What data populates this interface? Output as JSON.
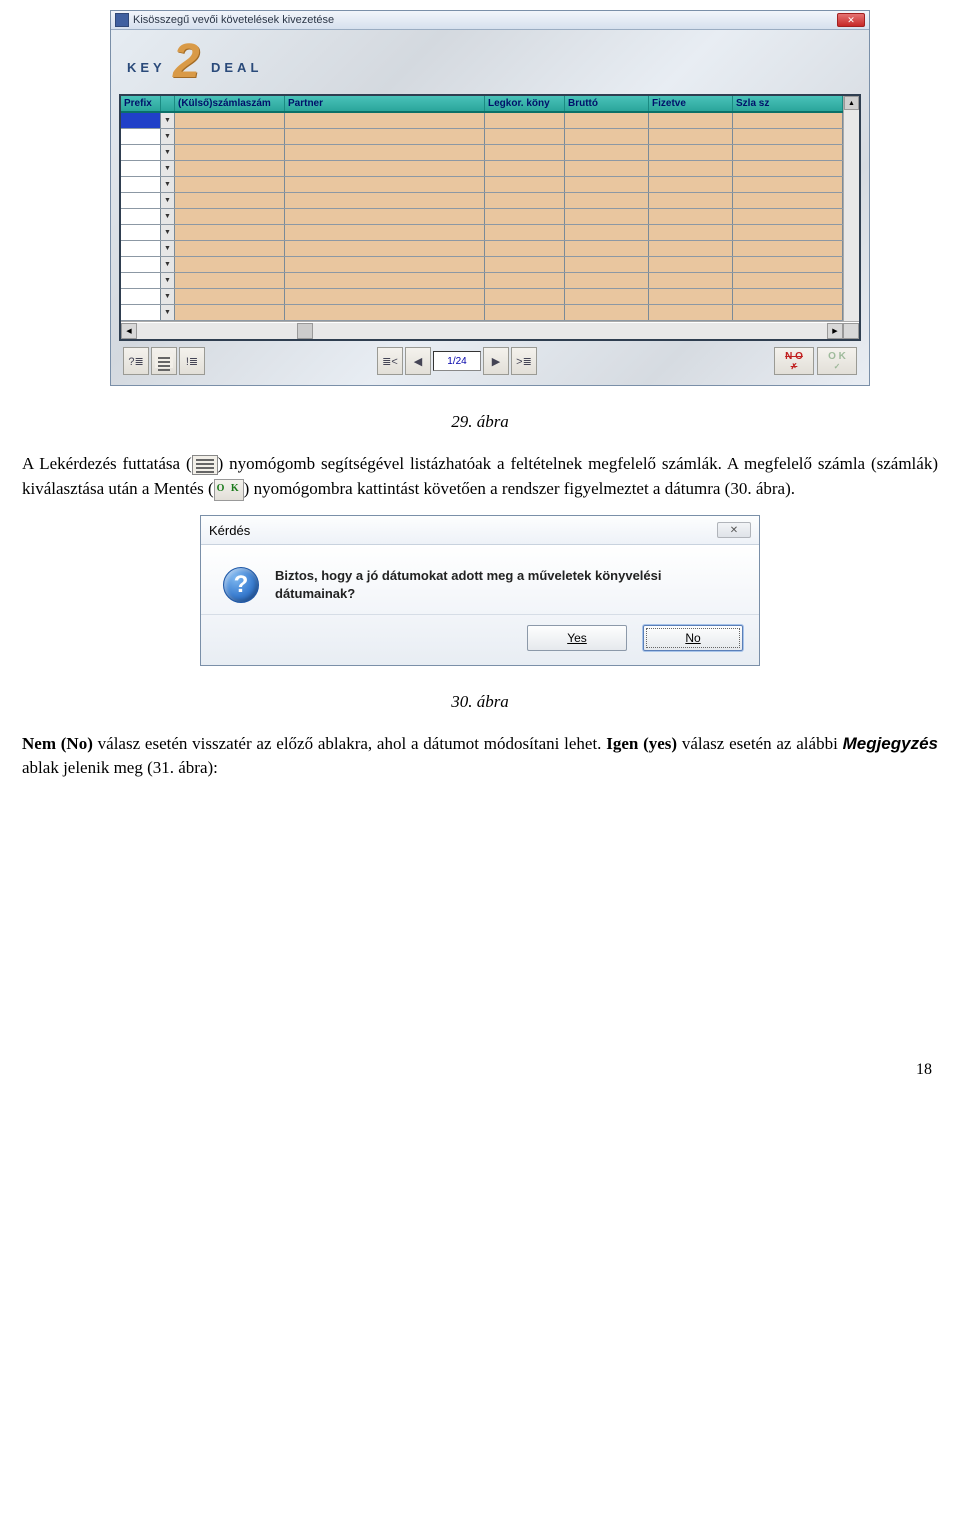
{
  "app1": {
    "title": "Kisösszegű vevői követelések kivezetése",
    "logo_key": "KEY",
    "logo_deal": "DEAL",
    "columns": {
      "prefix": "Prefix",
      "kulso": "(Külső)számlaszám",
      "partner": "Partner",
      "legkor": "Legkor. köny",
      "brutto": "Bruttó",
      "fizetve": "Fizetve",
      "szla": "Szla sz"
    },
    "dropdown_glyph": "▼",
    "page_indicator": "1/24",
    "no_label": "N O",
    "ok_label": "O K"
  },
  "caption1": "29. ábra",
  "paragraph1_a": "A Lekérdezés futtatása (",
  "paragraph1_b": ") nyomógomb segítségével listázhatóak a feltételnek megfelelő számlák. A megfelelő számla (számlák) kiválasztása után a Mentés (",
  "paragraph1_c": ") nyomógombra kattintást követően a rendszer figyelmeztet a dátumra (30. ábra).",
  "inline_ok": "O K",
  "dialog": {
    "title": "Kérdés",
    "message": "Biztos, hogy a jó dátumokat adott meg a műveletek könyvelési dátumainak?",
    "yes": "Yes",
    "no": "No"
  },
  "caption2": "30. ábra",
  "paragraph2": "Nem (No) válasz esetén visszatér az előző ablakra, ahol a dátumot módosítani lehet. Igen (yes) válasz esetén az alábbi Megjegyzés ablak jelenik meg (31. ábra):",
  "paragraph2_parts": {
    "a": "Nem (No)",
    "b": " válasz esetén visszatér az előző ablakra, ahol a dátumot módosítani lehet. ",
    "c": "Igen (yes)",
    "d": " válasz esetén az alábbi ",
    "e": "Megjegyzés",
    "f": " ablak jelenik meg (31. ábra):"
  },
  "page_number": "18"
}
